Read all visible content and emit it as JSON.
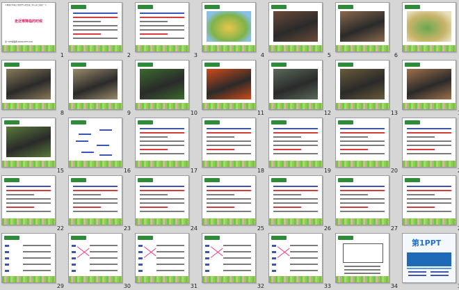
{
  "title_slide": {
    "top_text": "人教版七年级上册历史与社会第二单元第二课第一节",
    "title": "走近难降临的时候",
    "bottom_text": "第一PPT模板网-WWW.1PPT.COM"
  },
  "logo_slide": {
    "text": "第1PPT"
  },
  "slides": [
    {
      "num": "1",
      "type": "title"
    },
    {
      "num": "2",
      "type": "text"
    },
    {
      "num": "3",
      "type": "text"
    },
    {
      "num": "4",
      "type": "map"
    },
    {
      "num": "5",
      "type": "photo",
      "color": "#6b4a3a"
    },
    {
      "num": "6",
      "type": "photo",
      "color": "#8a6a4e"
    },
    {
      "num": "7",
      "type": "map2"
    },
    {
      "num": "8",
      "type": "photo",
      "color": "#8a7a5a"
    },
    {
      "num": "9",
      "type": "photo",
      "color": "#9a8a6a"
    },
    {
      "num": "10",
      "type": "photo",
      "color": "#3b6a2e"
    },
    {
      "num": "11",
      "type": "photo",
      "color": "#d04a1a"
    },
    {
      "num": "12",
      "type": "photo",
      "color": "#5a6a5a"
    },
    {
      "num": "13",
      "type": "photo",
      "color": "#6a5a3a"
    },
    {
      "num": "14",
      "type": "photo",
      "color": "#a0704a"
    },
    {
      "num": "15",
      "type": "photo",
      "color": "#5a7a3a"
    },
    {
      "num": "16",
      "type": "labels"
    },
    {
      "num": "17",
      "type": "text"
    },
    {
      "num": "18",
      "type": "text"
    },
    {
      "num": "19",
      "type": "text"
    },
    {
      "num": "20",
      "type": "text"
    },
    {
      "num": "21",
      "type": "text"
    },
    {
      "num": "22",
      "type": "text"
    },
    {
      "num": "23",
      "type": "text"
    },
    {
      "num": "24",
      "type": "text"
    },
    {
      "num": "25",
      "type": "text"
    },
    {
      "num": "26",
      "type": "text"
    },
    {
      "num": "27",
      "type": "text"
    },
    {
      "num": "28",
      "type": "text"
    },
    {
      "num": "29",
      "type": "match"
    },
    {
      "num": "30",
      "type": "matchx"
    },
    {
      "num": "31",
      "type": "matchx"
    },
    {
      "num": "32",
      "type": "matchx"
    },
    {
      "num": "33",
      "type": "matchx"
    },
    {
      "num": "34",
      "type": "table"
    },
    {
      "num": "35",
      "type": "logo"
    }
  ]
}
